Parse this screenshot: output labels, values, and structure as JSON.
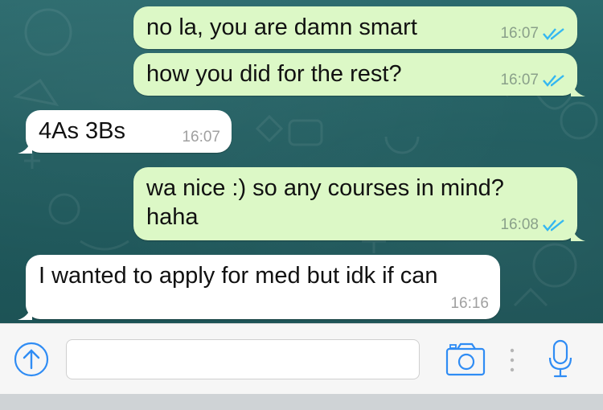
{
  "messages": [
    {
      "text": "no la, you are damn smart",
      "time": "16:07",
      "direction": "out",
      "status_icon": "double-check-icon"
    },
    {
      "text": "how you did for the rest?",
      "time": "16:07",
      "direction": "out",
      "status_icon": "double-check-icon"
    },
    {
      "text": "4As 3Bs",
      "time": "16:07",
      "direction": "in"
    },
    {
      "text": "wa nice :) so any courses in mind?\nhaha",
      "time": "16:08",
      "direction": "out",
      "status_icon": "double-check-icon"
    },
    {
      "text": "I wanted to apply for med but idk if can",
      "time": "16:16",
      "direction": "in"
    }
  ],
  "input_bar": {
    "attach_icon": "upload-arrow-icon",
    "placeholder": "",
    "camera_icon": "camera-icon",
    "mic_icon": "microphone-icon"
  },
  "colors": {
    "outgoing_bubble": "#dcf8c6",
    "incoming_bubble": "#ffffff",
    "accent": "#2f8cf4",
    "chat_background": "#245f62"
  }
}
